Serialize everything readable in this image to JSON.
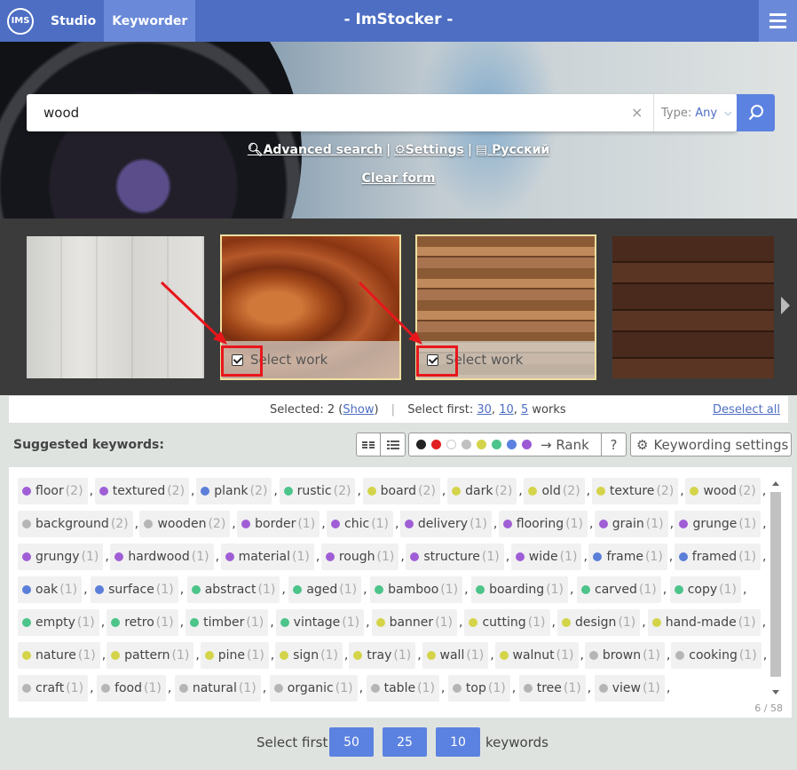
{
  "nav": {
    "logo": "IMS",
    "links": [
      "Studio",
      "Keyworder"
    ],
    "title": "- ImStocker -"
  },
  "search": {
    "value": "wood",
    "clear": "×",
    "type_label": "Type:",
    "type_value": "Any"
  },
  "hero_links": {
    "advanced": "Advanced search",
    "settings": "Settings",
    "language": "Русский",
    "clear_form": "Clear form"
  },
  "gallery": {
    "select_label": "Select work"
  },
  "selection": {
    "selected_label": "Selected:",
    "selected_count": "2",
    "show": "Show",
    "select_first_label": "Select first:",
    "options": [
      "30",
      "10",
      "5"
    ],
    "works": "works",
    "deselect": "Deselect all"
  },
  "suggested": {
    "title": "Suggested keywords:",
    "rank": "→ Rank",
    "help": "?",
    "settings": "Keywording settings"
  },
  "rank_dots": [
    "#222222",
    "#e02020",
    "#ffffff",
    "#c0c0c0",
    "#d4d44a",
    "#4cc48a",
    "#5b82e0",
    "#9b59d6"
  ],
  "colors": {
    "purple": "#a05ed6",
    "blue": "#5b7fd9",
    "green": "#4cc48a",
    "yellow": "#d4d44a",
    "gray": "#b5b5b5"
  },
  "keyword_rows": [
    [
      [
        "floor",
        "(2)",
        "purple"
      ],
      [
        "textured",
        "(2)",
        "purple"
      ],
      [
        "plank",
        "(2)",
        "blue"
      ],
      [
        "rustic",
        "(2)",
        "green"
      ],
      [
        "board",
        "(2)",
        "yellow"
      ],
      [
        "dark",
        "(2)",
        "yellow"
      ],
      [
        "old",
        "(2)",
        "yellow"
      ],
      [
        "texture",
        "(2)",
        "yellow"
      ],
      [
        "wood",
        "(2)",
        "yellow"
      ]
    ],
    [
      [
        "background",
        "(2)",
        "gray"
      ],
      [
        "wooden",
        "(2)",
        "gray"
      ],
      [
        "border",
        "(1)",
        "purple"
      ],
      [
        "chic",
        "(1)",
        "purple"
      ],
      [
        "delivery",
        "(1)",
        "purple"
      ],
      [
        "flooring",
        "(1)",
        "purple"
      ],
      [
        "grain",
        "(1)",
        "purple"
      ],
      [
        "grunge",
        "(1)",
        "purple"
      ]
    ],
    [
      [
        "grungy",
        "(1)",
        "purple"
      ],
      [
        "hardwood",
        "(1)",
        "purple"
      ],
      [
        "material",
        "(1)",
        "purple"
      ],
      [
        "rough",
        "(1)",
        "purple"
      ],
      [
        "structure",
        "(1)",
        "purple"
      ],
      [
        "wide",
        "(1)",
        "purple"
      ],
      [
        "frame",
        "(1)",
        "blue"
      ],
      [
        "framed",
        "(1)",
        "blue"
      ]
    ],
    [
      [
        "oak",
        "(1)",
        "blue"
      ],
      [
        "surface",
        "(1)",
        "blue"
      ],
      [
        "abstract",
        "(1)",
        "green"
      ],
      [
        "aged",
        "(1)",
        "green"
      ],
      [
        "bamboo",
        "(1)",
        "green"
      ],
      [
        "boarding",
        "(1)",
        "green"
      ],
      [
        "carved",
        "(1)",
        "green"
      ],
      [
        "copy",
        "(1)",
        "green"
      ]
    ],
    [
      [
        "empty",
        "(1)",
        "green"
      ],
      [
        "retro",
        "(1)",
        "green"
      ],
      [
        "timber",
        "(1)",
        "green"
      ],
      [
        "vintage",
        "(1)",
        "green"
      ],
      [
        "banner",
        "(1)",
        "yellow"
      ],
      [
        "cutting",
        "(1)",
        "yellow"
      ],
      [
        "design",
        "(1)",
        "yellow"
      ],
      [
        "hand-made",
        "(1)",
        "yellow"
      ]
    ],
    [
      [
        "nature",
        "(1)",
        "yellow"
      ],
      [
        "pattern",
        "(1)",
        "yellow"
      ],
      [
        "pine",
        "(1)",
        "yellow"
      ],
      [
        "sign",
        "(1)",
        "yellow"
      ],
      [
        "tray",
        "(1)",
        "yellow"
      ],
      [
        "wall",
        "(1)",
        "yellow"
      ],
      [
        "walnut",
        "(1)",
        "yellow"
      ],
      [
        "brown",
        "(1)",
        "gray"
      ],
      [
        "cooking",
        "(1)",
        "gray"
      ]
    ],
    [
      [
        "craft",
        "(1)",
        "gray"
      ],
      [
        "food",
        "(1)",
        "gray"
      ],
      [
        "natural",
        "(1)",
        "gray"
      ],
      [
        "organic",
        "(1)",
        "gray"
      ],
      [
        "table",
        "(1)",
        "gray"
      ],
      [
        "top",
        "(1)",
        "gray"
      ],
      [
        "tree",
        "(1)",
        "gray"
      ],
      [
        "view",
        "(1)",
        "gray"
      ]
    ]
  ],
  "counter": "6 / 58",
  "bottom": {
    "label": "Select first:",
    "options": [
      "50",
      "25",
      "10"
    ],
    "keywords": "keywords"
  }
}
